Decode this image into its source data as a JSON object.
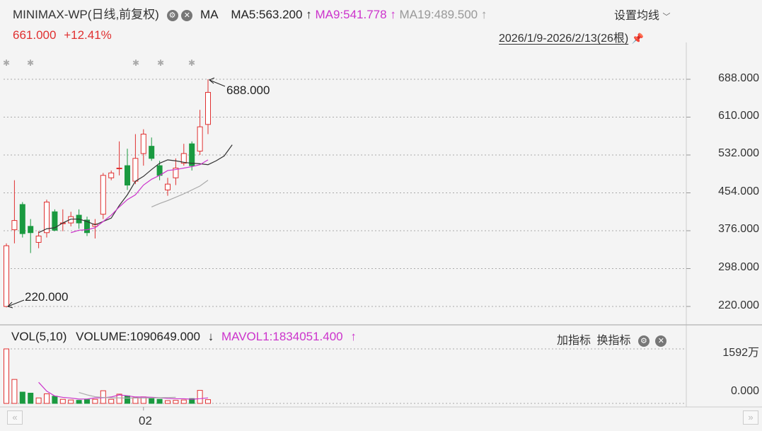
{
  "header": {
    "symbol": "MINIMAX-WP",
    "period_note": "(日线,前复权)",
    "ma_label": "MA",
    "ma5": "MA5:563.200",
    "ma9": "MA9:541.778",
    "ma19": "MA19:489.500",
    "arrow_up": "↑",
    "settings_label": "设置均线",
    "chevron": "﹀",
    "price": "661.000",
    "change": "+12.41%",
    "date_range": "2026/1/9-2026/2/13(26根)"
  },
  "volume_header": {
    "vol_label": "VOL(5,10)",
    "volume": "VOLUME:1090649.000",
    "arrow_down": "↓",
    "mavol1": "MAVOL1:1834051.400",
    "arrow_up": "↑",
    "add_indicator": "加指标",
    "switch_indicator": "换指标"
  },
  "colors": {
    "up": "#e03030",
    "down": "#1a9a40",
    "ma5": "#333333",
    "ma9": "#cc33cc",
    "ma19": "#aaaaaa",
    "grid": "#aaaaaa"
  },
  "chart_data": {
    "type": "candlestick",
    "price_axis": {
      "ticks": [
        "688.000",
        "610.000",
        "532.000",
        "454.000",
        "376.000",
        "298.000",
        "220.000"
      ],
      "ylim": [
        220,
        688
      ]
    },
    "volume_axis": {
      "ticks": [
        "1592万",
        "0.000"
      ],
      "ylim": [
        0,
        1592
      ]
    },
    "x_tick_label": "02",
    "x_tick_index": 17,
    "annotations": {
      "high": "688.000",
      "low": "220.000"
    },
    "candles": [
      {
        "o": 220,
        "h": 350,
        "l": 218,
        "c": 345
      },
      {
        "o": 378,
        "h": 480,
        "l": 350,
        "c": 397
      },
      {
        "o": 430,
        "h": 435,
        "l": 362,
        "c": 370
      },
      {
        "o": 385,
        "h": 400,
        "l": 330,
        "c": 372
      },
      {
        "o": 352,
        "h": 375,
        "l": 340,
        "c": 365
      },
      {
        "o": 372,
        "h": 440,
        "l": 362,
        "c": 435
      },
      {
        "o": 415,
        "h": 420,
        "l": 375,
        "c": 377
      },
      {
        "o": 392,
        "h": 420,
        "l": 375,
        "c": 392
      },
      {
        "o": 392,
        "h": 415,
        "l": 385,
        "c": 405
      },
      {
        "o": 408,
        "h": 420,
        "l": 380,
        "c": 392
      },
      {
        "o": 398,
        "h": 405,
        "l": 365,
        "c": 372
      },
      {
        "o": 385,
        "h": 400,
        "l": 360,
        "c": 390
      },
      {
        "o": 410,
        "h": 495,
        "l": 400,
        "c": 490
      },
      {
        "o": 485,
        "h": 500,
        "l": 480,
        "c": 495
      },
      {
        "o": 505,
        "h": 560,
        "l": 490,
        "c": 505
      },
      {
        "o": 510,
        "h": 545,
        "l": 460,
        "c": 470
      },
      {
        "o": 478,
        "h": 575,
        "l": 472,
        "c": 525
      },
      {
        "o": 535,
        "h": 585,
        "l": 510,
        "c": 575
      },
      {
        "o": 550,
        "h": 568,
        "l": 520,
        "c": 525
      },
      {
        "o": 510,
        "h": 520,
        "l": 480,
        "c": 490
      },
      {
        "o": 460,
        "h": 485,
        "l": 448,
        "c": 472
      },
      {
        "o": 485,
        "h": 525,
        "l": 470,
        "c": 505
      },
      {
        "o": 515,
        "h": 555,
        "l": 510,
        "c": 535
      },
      {
        "o": 555,
        "h": 560,
        "l": 500,
        "c": 510
      },
      {
        "o": 540,
        "h": 625,
        "l": 532,
        "c": 590
      },
      {
        "o": 595,
        "h": 688,
        "l": 575,
        "c": 661
      }
    ],
    "volumes": [
      1592,
      700,
      330,
      300,
      160,
      280,
      210,
      120,
      100,
      90,
      110,
      120,
      370,
      120,
      270,
      220,
      170,
      190,
      150,
      120,
      80,
      90,
      100,
      140,
      380,
      110
    ],
    "ma_series": [
      {
        "name": "MA5",
        "start": 4,
        "values": [
          372,
          380,
          382,
          392,
          400,
          400,
          395,
          388,
          395,
          402,
          428,
          450,
          478,
          488,
          502,
          515,
          522,
          520,
          517,
          515,
          514,
          512,
          520,
          530,
          553
        ]
      },
      {
        "name": "MA9",
        "start": 8,
        "values": [
          372,
          377,
          378,
          382,
          395,
          408,
          425,
          440,
          450,
          470,
          482,
          490,
          500,
          502,
          505,
          508,
          512,
          522
        ]
      },
      {
        "name": "MA19",
        "start": 18,
        "values": [
          425,
          432,
          438,
          445,
          452,
          460,
          468,
          480
        ]
      }
    ],
    "mavol_series": [
      {
        "name": "MAVOL1",
        "start": 4,
        "values": [
          616,
          358,
          216,
          177,
          156,
          126,
          128,
          162,
          164,
          188,
          248,
          224,
          188,
          186,
          180,
          166,
          146,
          136,
          136,
          122,
          138,
          162
        ]
      },
      {
        "name": "MAVOL2",
        "start": 9,
        "values": [
          320,
          250,
          195,
          175,
          165,
          160,
          155,
          160,
          158,
          160,
          165,
          172,
          178
        ]
      }
    ]
  }
}
